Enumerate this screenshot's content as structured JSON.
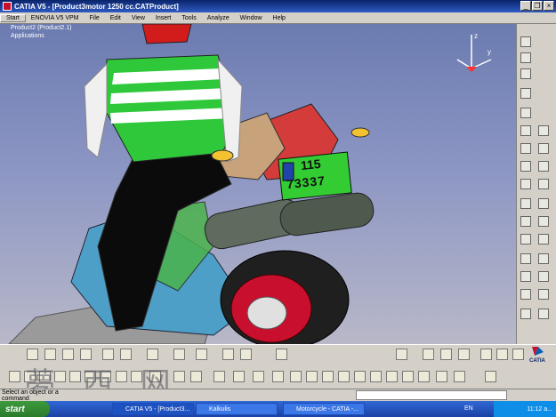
{
  "window": {
    "title": "CATIA V5 - [Product3motor  1250 cc.CATProduct]"
  },
  "menu": {
    "items": [
      "Start",
      "ENOVIA V5 VPM",
      "File",
      "Edit",
      "View",
      "Insert",
      "Tools",
      "Analyze",
      "Window",
      "Help"
    ]
  },
  "tree": {
    "root": "Product2 (Product2.1)",
    "child": "Applications"
  },
  "model": {
    "plate_top": "115",
    "plate_bottom": "73337"
  },
  "status": {
    "prompt": "Select an object or a command",
    "command_value": ""
  },
  "watermark": "夢 西 网",
  "taskbar": {
    "start_label": "start",
    "tasks": [
      {
        "label": "CATIA V5 - [Product3...",
        "active": true
      },
      {
        "label": "Kalkulis",
        "active": false
      },
      {
        "label": "Motorcycle - CATIA -...",
        "active": false
      }
    ],
    "lang": "EN",
    "clock": "11:12 a..."
  },
  "colors": {
    "title_bar": "#0a246a",
    "taskbar": "#3168d5",
    "viewport_top": "#6b7bb0",
    "shirt_green": "#31d43a",
    "plate_green": "#33cc33"
  }
}
